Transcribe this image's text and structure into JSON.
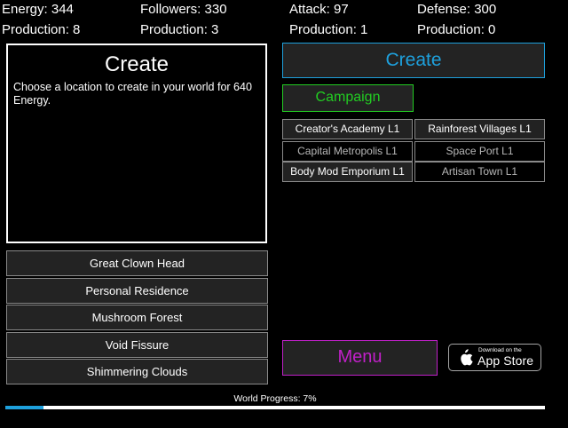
{
  "stats": {
    "energy": "Energy: 344",
    "followers": "Followers: 330",
    "attack": "Attack: 97",
    "defense": "Defense: 300",
    "energy_production": "Production: 8",
    "followers_production": "Production: 3",
    "attack_production": "Production: 1",
    "defense_production": "Production: 0"
  },
  "create_panel": {
    "title": "Create",
    "description": "Choose a location to create in your world for 640 Energy."
  },
  "locations": [
    "Great Clown Head",
    "Personal Residence",
    "Mushroom Forest",
    "Void Fissure",
    "Shimmering Clouds"
  ],
  "buttons": {
    "create": "Create",
    "campaign": "Campaign",
    "menu": "Menu"
  },
  "colors": {
    "create": "#1ea0dc",
    "campaign": "#22cc22",
    "menu": "#c020c8"
  },
  "buildings": [
    {
      "label": "Creator's Academy L1",
      "state": "active"
    },
    {
      "label": "Rainforest Villages L1",
      "state": "active"
    },
    {
      "label": "Capital Metropolis L1",
      "state": "dim"
    },
    {
      "label": "Space Port L1",
      "state": "dim"
    },
    {
      "label": "Body Mod Emporium L1",
      "state": "active"
    },
    {
      "label": "Artisan Town L1",
      "state": "dim"
    }
  ],
  "app_store": {
    "small_text": "Download on the",
    "big_text": "App Store",
    "icon": "apple-icon"
  },
  "progress": {
    "label": "World Progress: 7%",
    "value": 7
  }
}
